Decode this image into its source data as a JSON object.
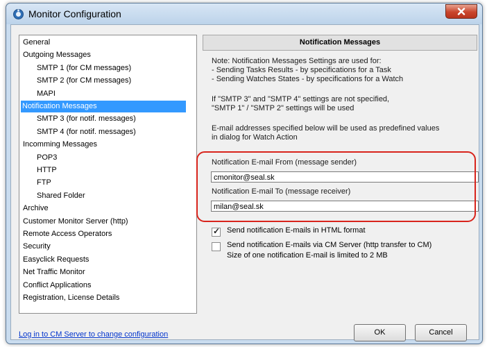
{
  "window": {
    "title": "Monitor Configuration",
    "close_symbol": "X",
    "icons": {
      "app": "app-config-icon",
      "close": "close-icon"
    }
  },
  "tree": {
    "items": [
      {
        "label": "General",
        "level": 0
      },
      {
        "label": "Outgoing Messages",
        "level": 0
      },
      {
        "label": "SMTP 1 (for CM messages)",
        "level": 1
      },
      {
        "label": "SMTP 2 (for CM messages)",
        "level": 1
      },
      {
        "label": "MAPI",
        "level": 1
      },
      {
        "label": "Notification Messages",
        "level": 0,
        "selected": true
      },
      {
        "label": "SMTP 3 (for notif. messages)",
        "level": 1
      },
      {
        "label": "SMTP 4 (for notif. messages)",
        "level": 1
      },
      {
        "label": "Incomming Messages",
        "level": 0
      },
      {
        "label": "POP3",
        "level": 1
      },
      {
        "label": "HTTP",
        "level": 1
      },
      {
        "label": "FTP",
        "level": 1
      },
      {
        "label": "Shared Folder",
        "level": 1
      },
      {
        "label": "Archive",
        "level": 0
      },
      {
        "label": "Customer Monitor Server (http)",
        "level": 0
      },
      {
        "label": "Remote Access Operators",
        "level": 0
      },
      {
        "label": "Security",
        "level": 0
      },
      {
        "label": "Easyclick Requests",
        "level": 0
      },
      {
        "label": "Net Traffic Monitor",
        "level": 0
      },
      {
        "label": "Conflict Applications",
        "level": 0
      },
      {
        "label": "Registration, License Details",
        "level": 0
      }
    ]
  },
  "panel": {
    "title": "Notification Messages",
    "note_lines": [
      "Note: Notification Messages Settings are used for:",
      " - Sending Tasks Results - by specifications for a Task",
      " - Sending Watches States - by specifications for a Watch"
    ],
    "smtp_note_lines": [
      "If \"SMTP 3\" and \"SMTP 4\" settings are not specified,",
      "\"SMTP 1\" / \"SMTP 2\" settings will be used"
    ],
    "email_note_lines": [
      "E-mail addresses specified below will be used as predefined values",
      "in dialog for Watch Action"
    ],
    "from_label": "Notification E-mail From (message sender)",
    "from_value": "cmonitor@seal.sk",
    "to_label": "Notification E-mail To (message receiver)",
    "to_value": "milan@seal.sk",
    "html_format_label": "Send notification E-mails in HTML format",
    "html_format_checked": true,
    "via_server_label": "Send notification E-mails via CM Server (http transfer to CM)",
    "via_server_checked": false,
    "size_note": "Size of one notification E-mail is limited to 2 MB"
  },
  "footer": {
    "login_link": "Log in to CM Server to change configuration",
    "ok_label": "OK",
    "cancel_label": "Cancel"
  },
  "colors": {
    "selection": "#3399ff",
    "highlight": "#d8231b",
    "link": "#0033cc"
  }
}
